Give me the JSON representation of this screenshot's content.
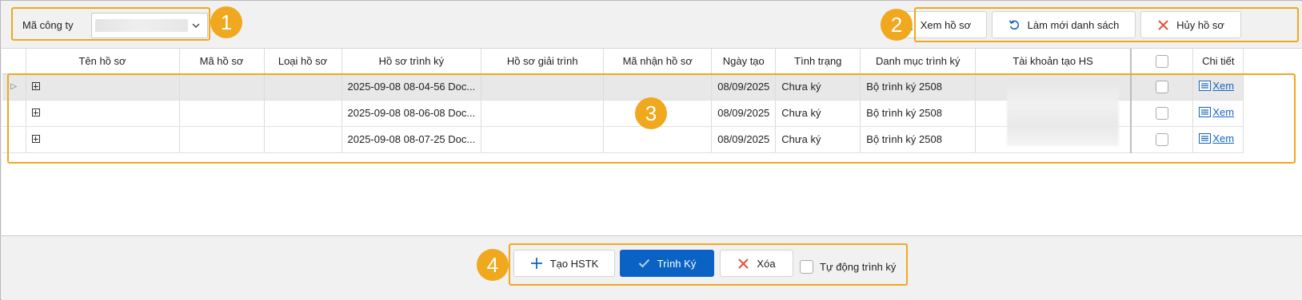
{
  "annotations": [
    "1",
    "2",
    "3",
    "4"
  ],
  "company": {
    "label": "Mã công ty",
    "value": ""
  },
  "toolbar": {
    "view_label": "Xem hồ sơ",
    "refresh_label": "Làm mới danh sách",
    "cancel_label": "Hủy hồ sơ"
  },
  "grid": {
    "columns": [
      "Tên hồ sơ",
      "Mã hồ sơ",
      "Loại hồ sơ",
      "Hồ sơ trình ký",
      "Hồ sơ giải trình",
      "Mã nhận hồ sơ",
      "Ngày tạo",
      "Tình trạng",
      "Danh mục trình ký",
      "Tài khoản tạo HS",
      "",
      "Chi tiết"
    ],
    "rows": [
      {
        "ten": "",
        "ma": "",
        "loai": "",
        "ho_so_trinh_ky": "2025-09-08 08-04-56 Doc...",
        "giai_trinh": "",
        "ma_nhan": "",
        "ngay_tao": "08/09/2025",
        "tinh_trang": "Chưa ký",
        "danh_muc": "Bộ trình ký 2508",
        "tai_khoan": "",
        "chi_tiet": "Xem",
        "selected": true
      },
      {
        "ten": "",
        "ma": "",
        "loai": "",
        "ho_so_trinh_ky": "2025-09-08 08-06-08 Doc...",
        "giai_trinh": "",
        "ma_nhan": "",
        "ngay_tao": "08/09/2025",
        "tinh_trang": "Chưa ký",
        "danh_muc": "Bộ trình ký 2508",
        "tai_khoan": "",
        "chi_tiet": "Xem",
        "selected": false
      },
      {
        "ten": "",
        "ma": "",
        "loai": "",
        "ho_so_trinh_ky": "2025-09-08 08-07-25 Doc...",
        "giai_trinh": "",
        "ma_nhan": "",
        "ngay_tao": "08/09/2025",
        "tinh_trang": "Chưa ký",
        "danh_muc": "Bộ trình ký 2508",
        "tai_khoan": "",
        "chi_tiet": "Xem",
        "selected": false
      }
    ]
  },
  "bottom": {
    "create_label": "Tạo HSTK",
    "submit_label": "Trình Ký",
    "delete_label": "Xóa",
    "auto_sign_label": "Tự động trình ký"
  },
  "colors": {
    "annotation": "#f0a81e",
    "primary": "#0a63c4",
    "danger": "#e0533b",
    "link": "#1565c0"
  }
}
